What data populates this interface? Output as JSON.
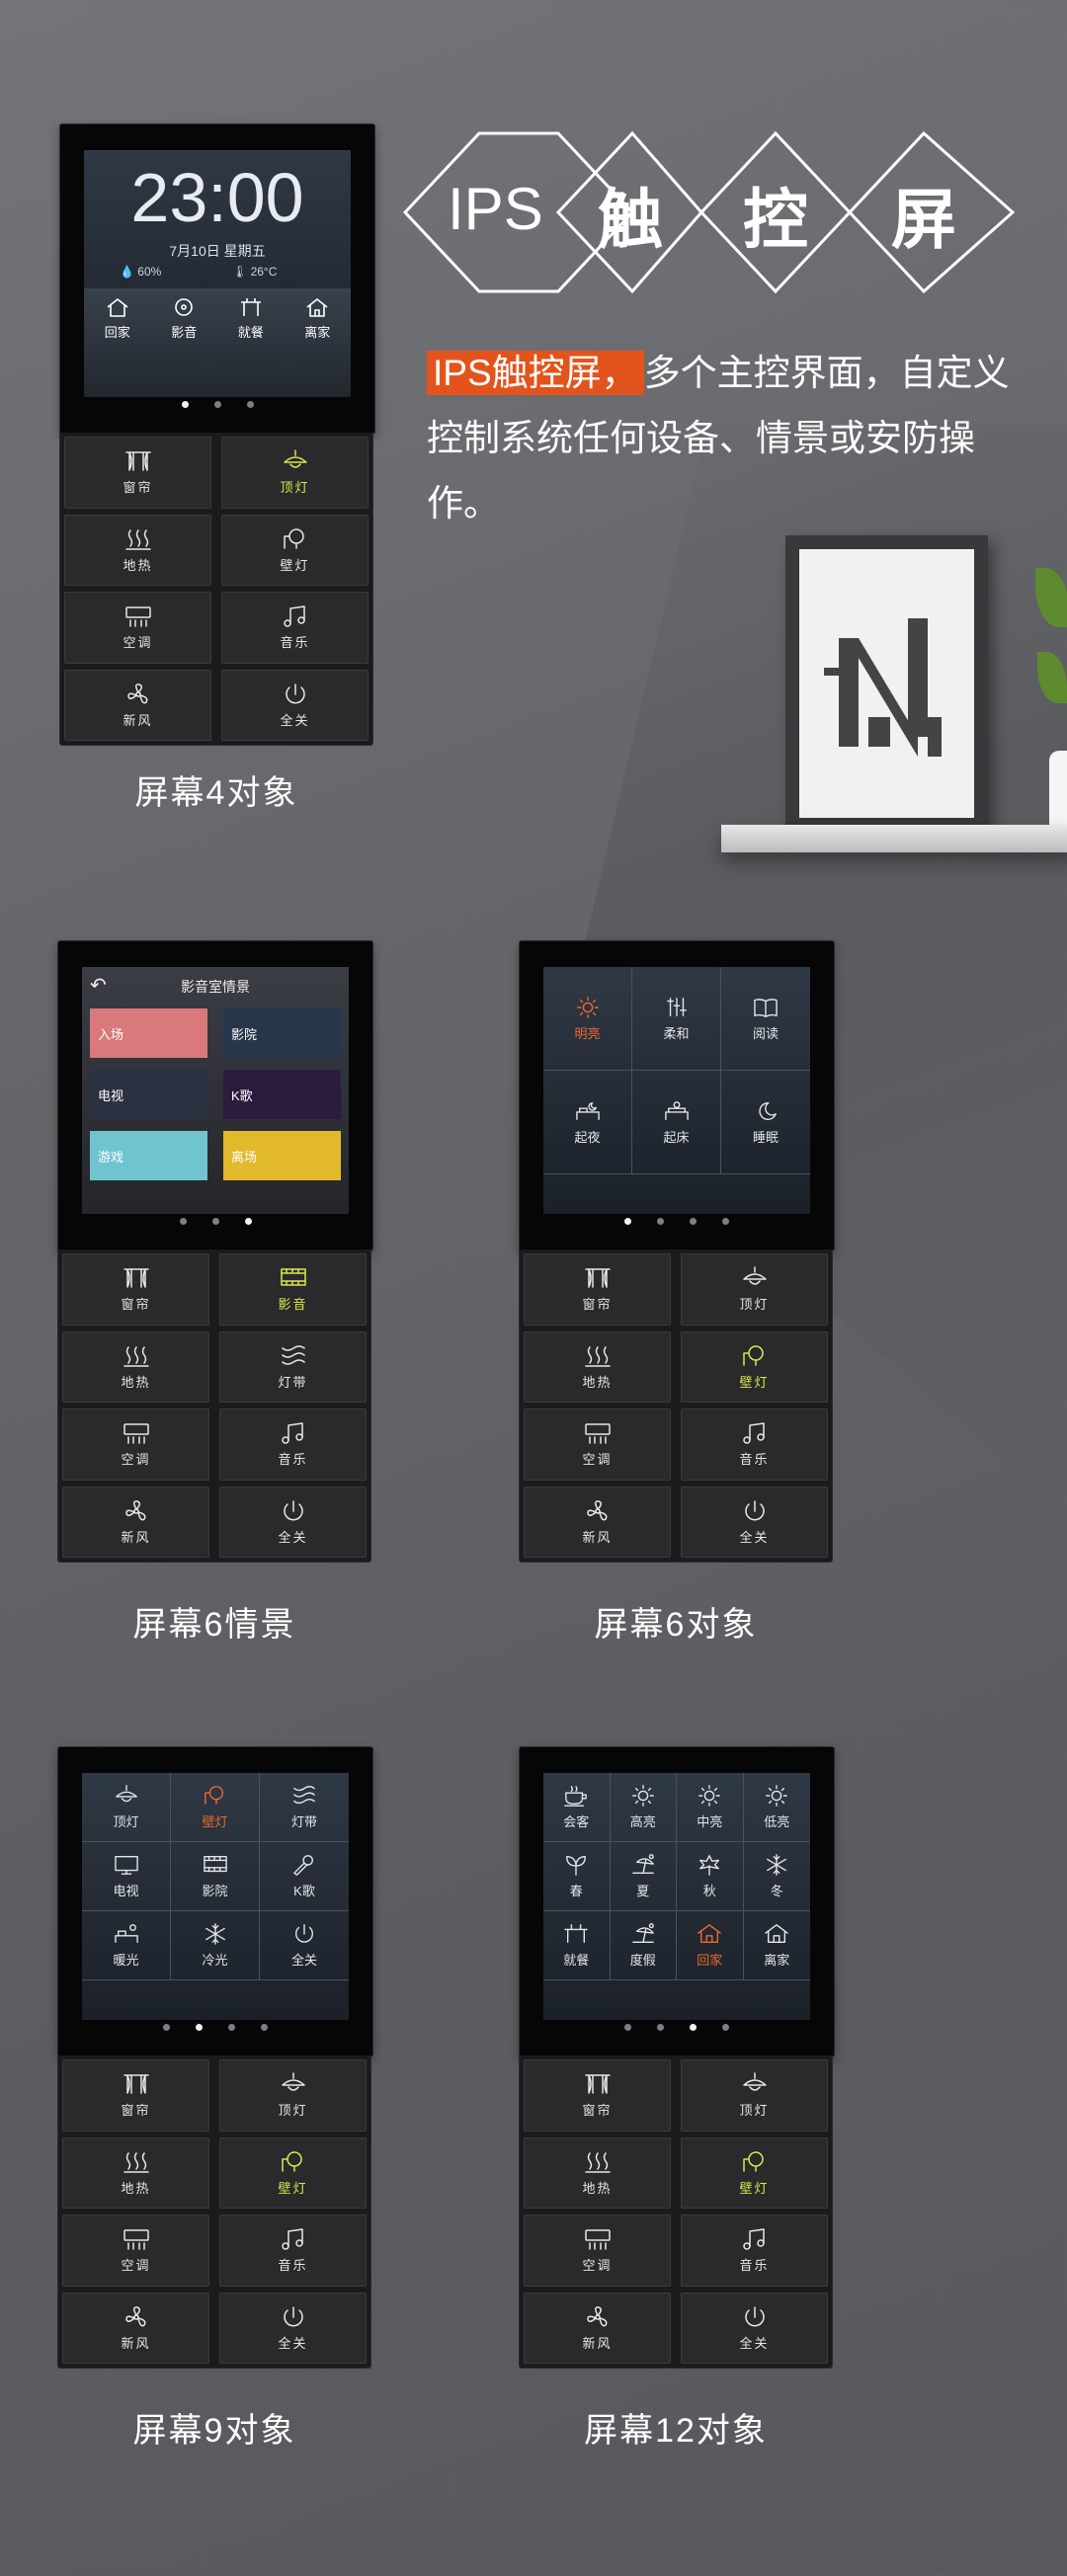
{
  "headline": {
    "chars": [
      "IPS",
      "触",
      "控",
      "屏"
    ]
  },
  "description": {
    "highlight": "IPS触控屏，",
    "text": "多个主控界面，自定义控制系统任何设备、情景或安防操作。"
  },
  "panels": [
    {
      "caption": "屏幕4对象",
      "clock": {
        "time": "23:00",
        "date": "7月10日 星期五",
        "humidity": "60%",
        "temperature": "26°C"
      },
      "home_shortcuts": [
        {
          "label": "回家",
          "icon": "home-icon"
        },
        {
          "label": "影音",
          "icon": "film-icon"
        },
        {
          "label": "就餐",
          "icon": "dining-icon"
        },
        {
          "label": "离家",
          "icon": "leave-home-icon"
        }
      ],
      "buttons": [
        {
          "label": "窗帘",
          "icon": "curtain-icon",
          "active": false
        },
        {
          "label": "顶灯",
          "icon": "ceiling-lamp-icon",
          "active": true
        },
        {
          "label": "地热",
          "icon": "floor-heat-icon",
          "active": false
        },
        {
          "label": "壁灯",
          "icon": "wall-lamp-icon",
          "active": false
        },
        {
          "label": "空调",
          "icon": "aircon-icon",
          "active": false
        },
        {
          "label": "音乐",
          "icon": "music-icon",
          "active": false
        },
        {
          "label": "新风",
          "icon": "fan-icon",
          "active": false
        },
        {
          "label": "全关",
          "icon": "power-icon",
          "active": false
        }
      ]
    },
    {
      "caption": "屏幕6情景",
      "scene_screen": {
        "header": "影音室情景",
        "tiles": [
          {
            "label": "入场",
            "color": "#d9797b"
          },
          {
            "label": "影院",
            "color": "#27364a"
          },
          {
            "label": "电视",
            "color": "#2b3140"
          },
          {
            "label": "K歌",
            "color": "#2b1b3d"
          },
          {
            "label": "游戏",
            "color": "#6fc4cf"
          },
          {
            "label": "离场",
            "color": "#e3b92c"
          }
        ]
      },
      "buttons": [
        {
          "label": "窗帘",
          "icon": "curtain-icon",
          "active": false
        },
        {
          "label": "影音",
          "icon": "film-icon",
          "active": true
        },
        {
          "label": "地热",
          "icon": "floor-heat-icon",
          "active": false
        },
        {
          "label": "灯带",
          "icon": "light-strip-icon",
          "active": false
        },
        {
          "label": "空调",
          "icon": "aircon-icon",
          "active": false
        },
        {
          "label": "音乐",
          "icon": "music-icon",
          "active": false
        },
        {
          "label": "新风",
          "icon": "fan-icon",
          "active": false
        },
        {
          "label": "全关",
          "icon": "power-icon",
          "active": false
        }
      ]
    },
    {
      "caption": "屏幕6对象",
      "grid": [
        {
          "label": "明亮",
          "icon": "sun-icon",
          "active": true
        },
        {
          "label": "柔和",
          "icon": "soft-light-icon",
          "active": false
        },
        {
          "label": "阅读",
          "icon": "book-icon",
          "active": false
        },
        {
          "label": "起夜",
          "icon": "night-up-icon",
          "active": false
        },
        {
          "label": "起床",
          "icon": "wake-up-icon",
          "active": false
        },
        {
          "label": "睡眠",
          "icon": "moon-icon",
          "active": false
        }
      ],
      "buttons": [
        {
          "label": "窗帘",
          "icon": "curtain-icon",
          "active": false
        },
        {
          "label": "顶灯",
          "icon": "ceiling-lamp-icon",
          "active": false
        },
        {
          "label": "地热",
          "icon": "floor-heat-icon",
          "active": false
        },
        {
          "label": "壁灯",
          "icon": "wall-lamp-icon",
          "active": true
        },
        {
          "label": "空调",
          "icon": "aircon-icon",
          "active": false
        },
        {
          "label": "音乐",
          "icon": "music-icon",
          "active": false
        },
        {
          "label": "新风",
          "icon": "fan-icon",
          "active": false
        },
        {
          "label": "全关",
          "icon": "power-icon",
          "active": false
        }
      ]
    },
    {
      "caption": "屏幕9对象",
      "grid": [
        {
          "label": "顶灯",
          "icon": "ceiling-lamp-icon",
          "active": false
        },
        {
          "label": "壁灯",
          "icon": "wall-lamp-icon",
          "active": true
        },
        {
          "label": "灯带",
          "icon": "light-strip-icon",
          "active": false
        },
        {
          "label": "电视",
          "icon": "tv-icon",
          "active": false
        },
        {
          "label": "影院",
          "icon": "film-icon",
          "active": false
        },
        {
          "label": "K歌",
          "icon": "mic-icon",
          "active": false
        },
        {
          "label": "暖光",
          "icon": "warm-light-icon",
          "active": false
        },
        {
          "label": "冷光",
          "icon": "snowflake-icon",
          "active": false
        },
        {
          "label": "全关",
          "icon": "power-icon",
          "active": false
        }
      ],
      "buttons": [
        {
          "label": "窗帘",
          "icon": "curtain-icon",
          "active": false
        },
        {
          "label": "顶灯",
          "icon": "ceiling-lamp-icon",
          "active": false
        },
        {
          "label": "地热",
          "icon": "floor-heat-icon",
          "active": false
        },
        {
          "label": "壁灯",
          "icon": "wall-lamp-icon",
          "active": true
        },
        {
          "label": "空调",
          "icon": "aircon-icon",
          "active": false
        },
        {
          "label": "音乐",
          "icon": "music-icon",
          "active": false
        },
        {
          "label": "新风",
          "icon": "fan-icon",
          "active": false
        },
        {
          "label": "全关",
          "icon": "power-icon",
          "active": false
        }
      ]
    },
    {
      "caption": "屏幕12对象",
      "grid": [
        {
          "label": "会客",
          "icon": "tea-cup-icon",
          "active": false
        },
        {
          "label": "高亮",
          "icon": "sun-icon",
          "active": false
        },
        {
          "label": "中亮",
          "icon": "sun-icon",
          "active": false
        },
        {
          "label": "低亮",
          "icon": "sun-icon",
          "active": false
        },
        {
          "label": "春",
          "icon": "leaf-icon",
          "active": false
        },
        {
          "label": "夏",
          "icon": "beach-icon",
          "active": false
        },
        {
          "label": "秋",
          "icon": "maple-icon",
          "active": false
        },
        {
          "label": "冬",
          "icon": "snowflake-icon",
          "active": false
        },
        {
          "label": "就餐",
          "icon": "dining-icon",
          "active": false
        },
        {
          "label": "度假",
          "icon": "beach-icon",
          "active": false
        },
        {
          "label": "回家",
          "icon": "home-icon",
          "active": true
        },
        {
          "label": "离家",
          "icon": "leave-home-icon",
          "active": false
        }
      ],
      "buttons": [
        {
          "label": "窗帘",
          "icon": "curtain-icon",
          "active": false
        },
        {
          "label": "顶灯",
          "icon": "ceiling-lamp-icon",
          "active": false
        },
        {
          "label": "地热",
          "icon": "floor-heat-icon",
          "active": false
        },
        {
          "label": "壁灯",
          "icon": "wall-lamp-icon",
          "active": true
        },
        {
          "label": "空调",
          "icon": "aircon-icon",
          "active": false
        },
        {
          "label": "音乐",
          "icon": "music-icon",
          "active": false
        },
        {
          "label": "新风",
          "icon": "fan-icon",
          "active": false
        },
        {
          "label": "全关",
          "icon": "power-icon",
          "active": false
        }
      ]
    }
  ],
  "colors": {
    "highlight": "#e3541c",
    "active_green": "#d9e84a",
    "active_orange": "#ea6a2c"
  }
}
